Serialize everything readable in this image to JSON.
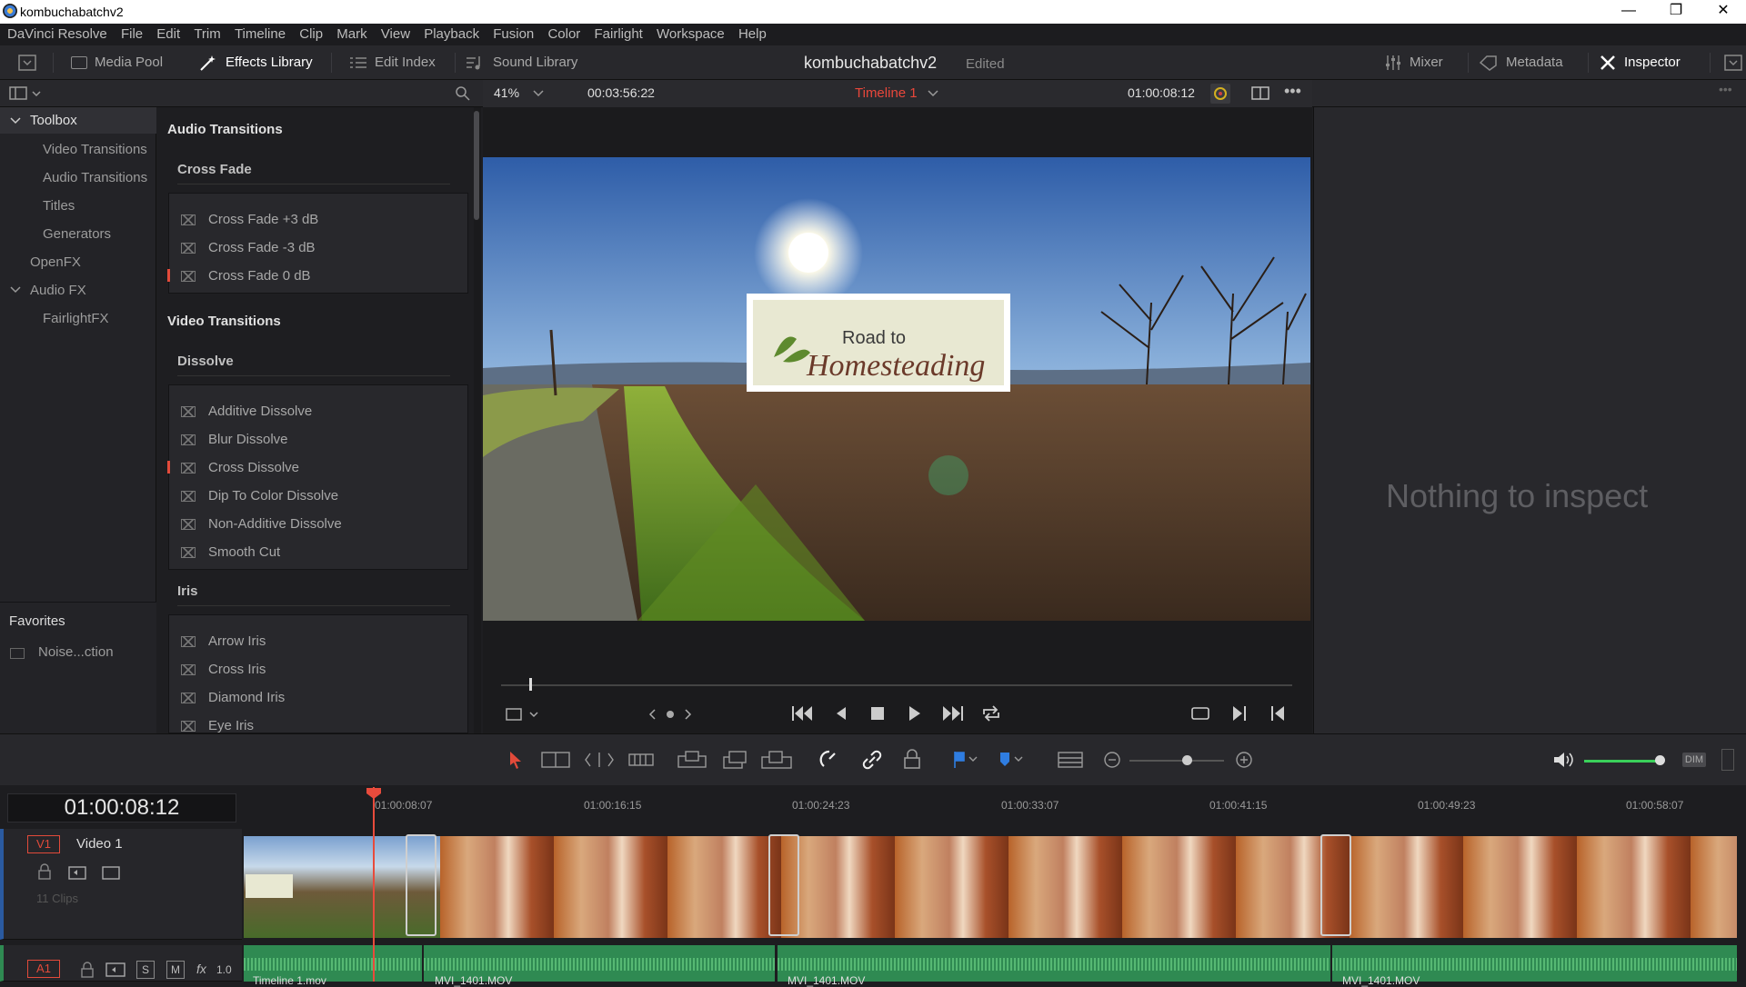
{
  "window": {
    "title": "kombuchabatchv2",
    "min": "—",
    "restore": "❐",
    "close": "✕"
  },
  "menu": [
    "DaVinci Resolve",
    "File",
    "Edit",
    "Trim",
    "Timeline",
    "Clip",
    "Mark",
    "View",
    "Playback",
    "Fusion",
    "Color",
    "Fairlight",
    "Workspace",
    "Help"
  ],
  "toolbar": {
    "media_pool": "Media Pool",
    "effects_library": "Effects Library",
    "edit_index": "Edit Index",
    "sound_library": "Sound Library",
    "project_name": "kombuchabatchv2",
    "edited": "Edited",
    "mixer": "Mixer",
    "metadata": "Metadata",
    "inspector": "Inspector"
  },
  "viewer_bar": {
    "zoom": "41%",
    "duration": "00:03:56:22",
    "timeline_name": "Timeline 1",
    "timecode": "01:00:08:12"
  },
  "toolbox": {
    "root": "Toolbox",
    "items": [
      "Video Transitions",
      "Audio Transitions",
      "Titles",
      "Generators"
    ],
    "openfx": "OpenFX",
    "audiofx": "Audio FX",
    "fairlightfx": "FairlightFX"
  },
  "favorites": {
    "title": "Favorites",
    "items": [
      "Noise...ction"
    ]
  },
  "effects": {
    "audio_title": "Audio Transitions",
    "crossfade_title": "Cross Fade",
    "crossfade": [
      "Cross Fade +3 dB",
      "Cross Fade -3 dB",
      "Cross Fade 0 dB"
    ],
    "video_title": "Video Transitions",
    "dissolve_title": "Dissolve",
    "dissolve": [
      "Additive Dissolve",
      "Blur Dissolve",
      "Cross Dissolve",
      "Dip To Color Dissolve",
      "Non-Additive Dissolve",
      "Smooth Cut"
    ],
    "iris_title": "Iris",
    "iris": [
      "Arrow Iris",
      "Cross Iris",
      "Diamond Iris",
      "Eye Iris"
    ]
  },
  "title_card": {
    "line1": "Road to",
    "line2": "Homesteading"
  },
  "inspector": {
    "empty": "Nothing to inspect"
  },
  "timeline": {
    "timecode": "01:00:08:12",
    "ruler": [
      "01:00:08:07",
      "01:00:16:15",
      "01:00:24:23",
      "01:00:33:07",
      "01:00:41:15",
      "01:00:49:23",
      "01:00:58:07"
    ],
    "video_track": {
      "id": "V1",
      "name": "Video 1",
      "clips": "11 Clips"
    },
    "audio_track": {
      "id": "A1",
      "solo": "S",
      "mute": "M",
      "fx": "fx",
      "gain": "1.0"
    },
    "audio_clips": [
      "Timeline 1.mov",
      "MVI_1401.MOV",
      "MVI_1401.MOV",
      "MVI_1401.MOV"
    ]
  },
  "audio_controls": {
    "dim": "DIM"
  },
  "colors": {
    "accent_red": "#e24a3a",
    "audio_green": "#2f8a52",
    "timeline_name": "#e8473b",
    "playhead": "#e84b3c"
  }
}
